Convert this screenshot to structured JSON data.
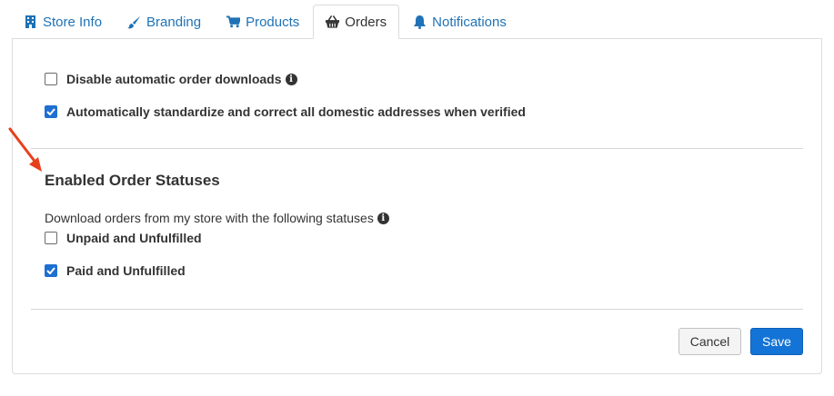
{
  "tabs": [
    {
      "label": "Store Info",
      "icon": "building-icon",
      "active": false
    },
    {
      "label": "Branding",
      "icon": "paintbrush-icon",
      "active": false
    },
    {
      "label": "Products",
      "icon": "cart-icon",
      "active": false
    },
    {
      "label": "Orders",
      "icon": "basket-icon",
      "active": true
    },
    {
      "label": "Notifications",
      "icon": "bell-icon",
      "active": false
    }
  ],
  "options": {
    "disable_downloads": {
      "label": "Disable automatic order downloads",
      "checked": false
    },
    "standardize_addresses": {
      "label": "Automatically standardize and correct all domestic addresses when verified",
      "checked": true
    }
  },
  "statuses": {
    "title": "Enabled Order Statuses",
    "description": "Download orders from my store with the following statuses",
    "unpaid_unfulfilled": {
      "label": "Unpaid and Unfulfilled",
      "checked": false
    },
    "paid_unfulfilled": {
      "label": "Paid and Unfulfilled",
      "checked": true
    }
  },
  "actions": {
    "cancel_label": "Cancel",
    "save_label": "Save"
  },
  "colors": {
    "link": "#1f72b6",
    "primary": "#1473d6",
    "annotation_arrow": "#e8401c"
  }
}
